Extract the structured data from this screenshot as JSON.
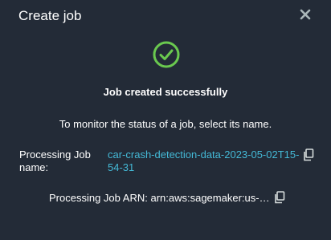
{
  "modal": {
    "title": "Create job",
    "close_icon": "close-icon",
    "success_icon": "check-circle-icon",
    "success_color": "#6ac94f",
    "headline": "Job created successfully",
    "instruction": "To monitor the status of a job, select its name.",
    "processing_job_name_label": "Processing Job name:",
    "processing_job_name_value": "car-crash-detection-data-2023-05-02T15-54-31",
    "processing_job_arn_label": "Processing Job ARN:",
    "processing_job_arn_value": "arn:aws:sagemaker:us-west…",
    "copy_icon": "copy-icon",
    "link_color": "#44b9d6",
    "background": "#232b37"
  }
}
